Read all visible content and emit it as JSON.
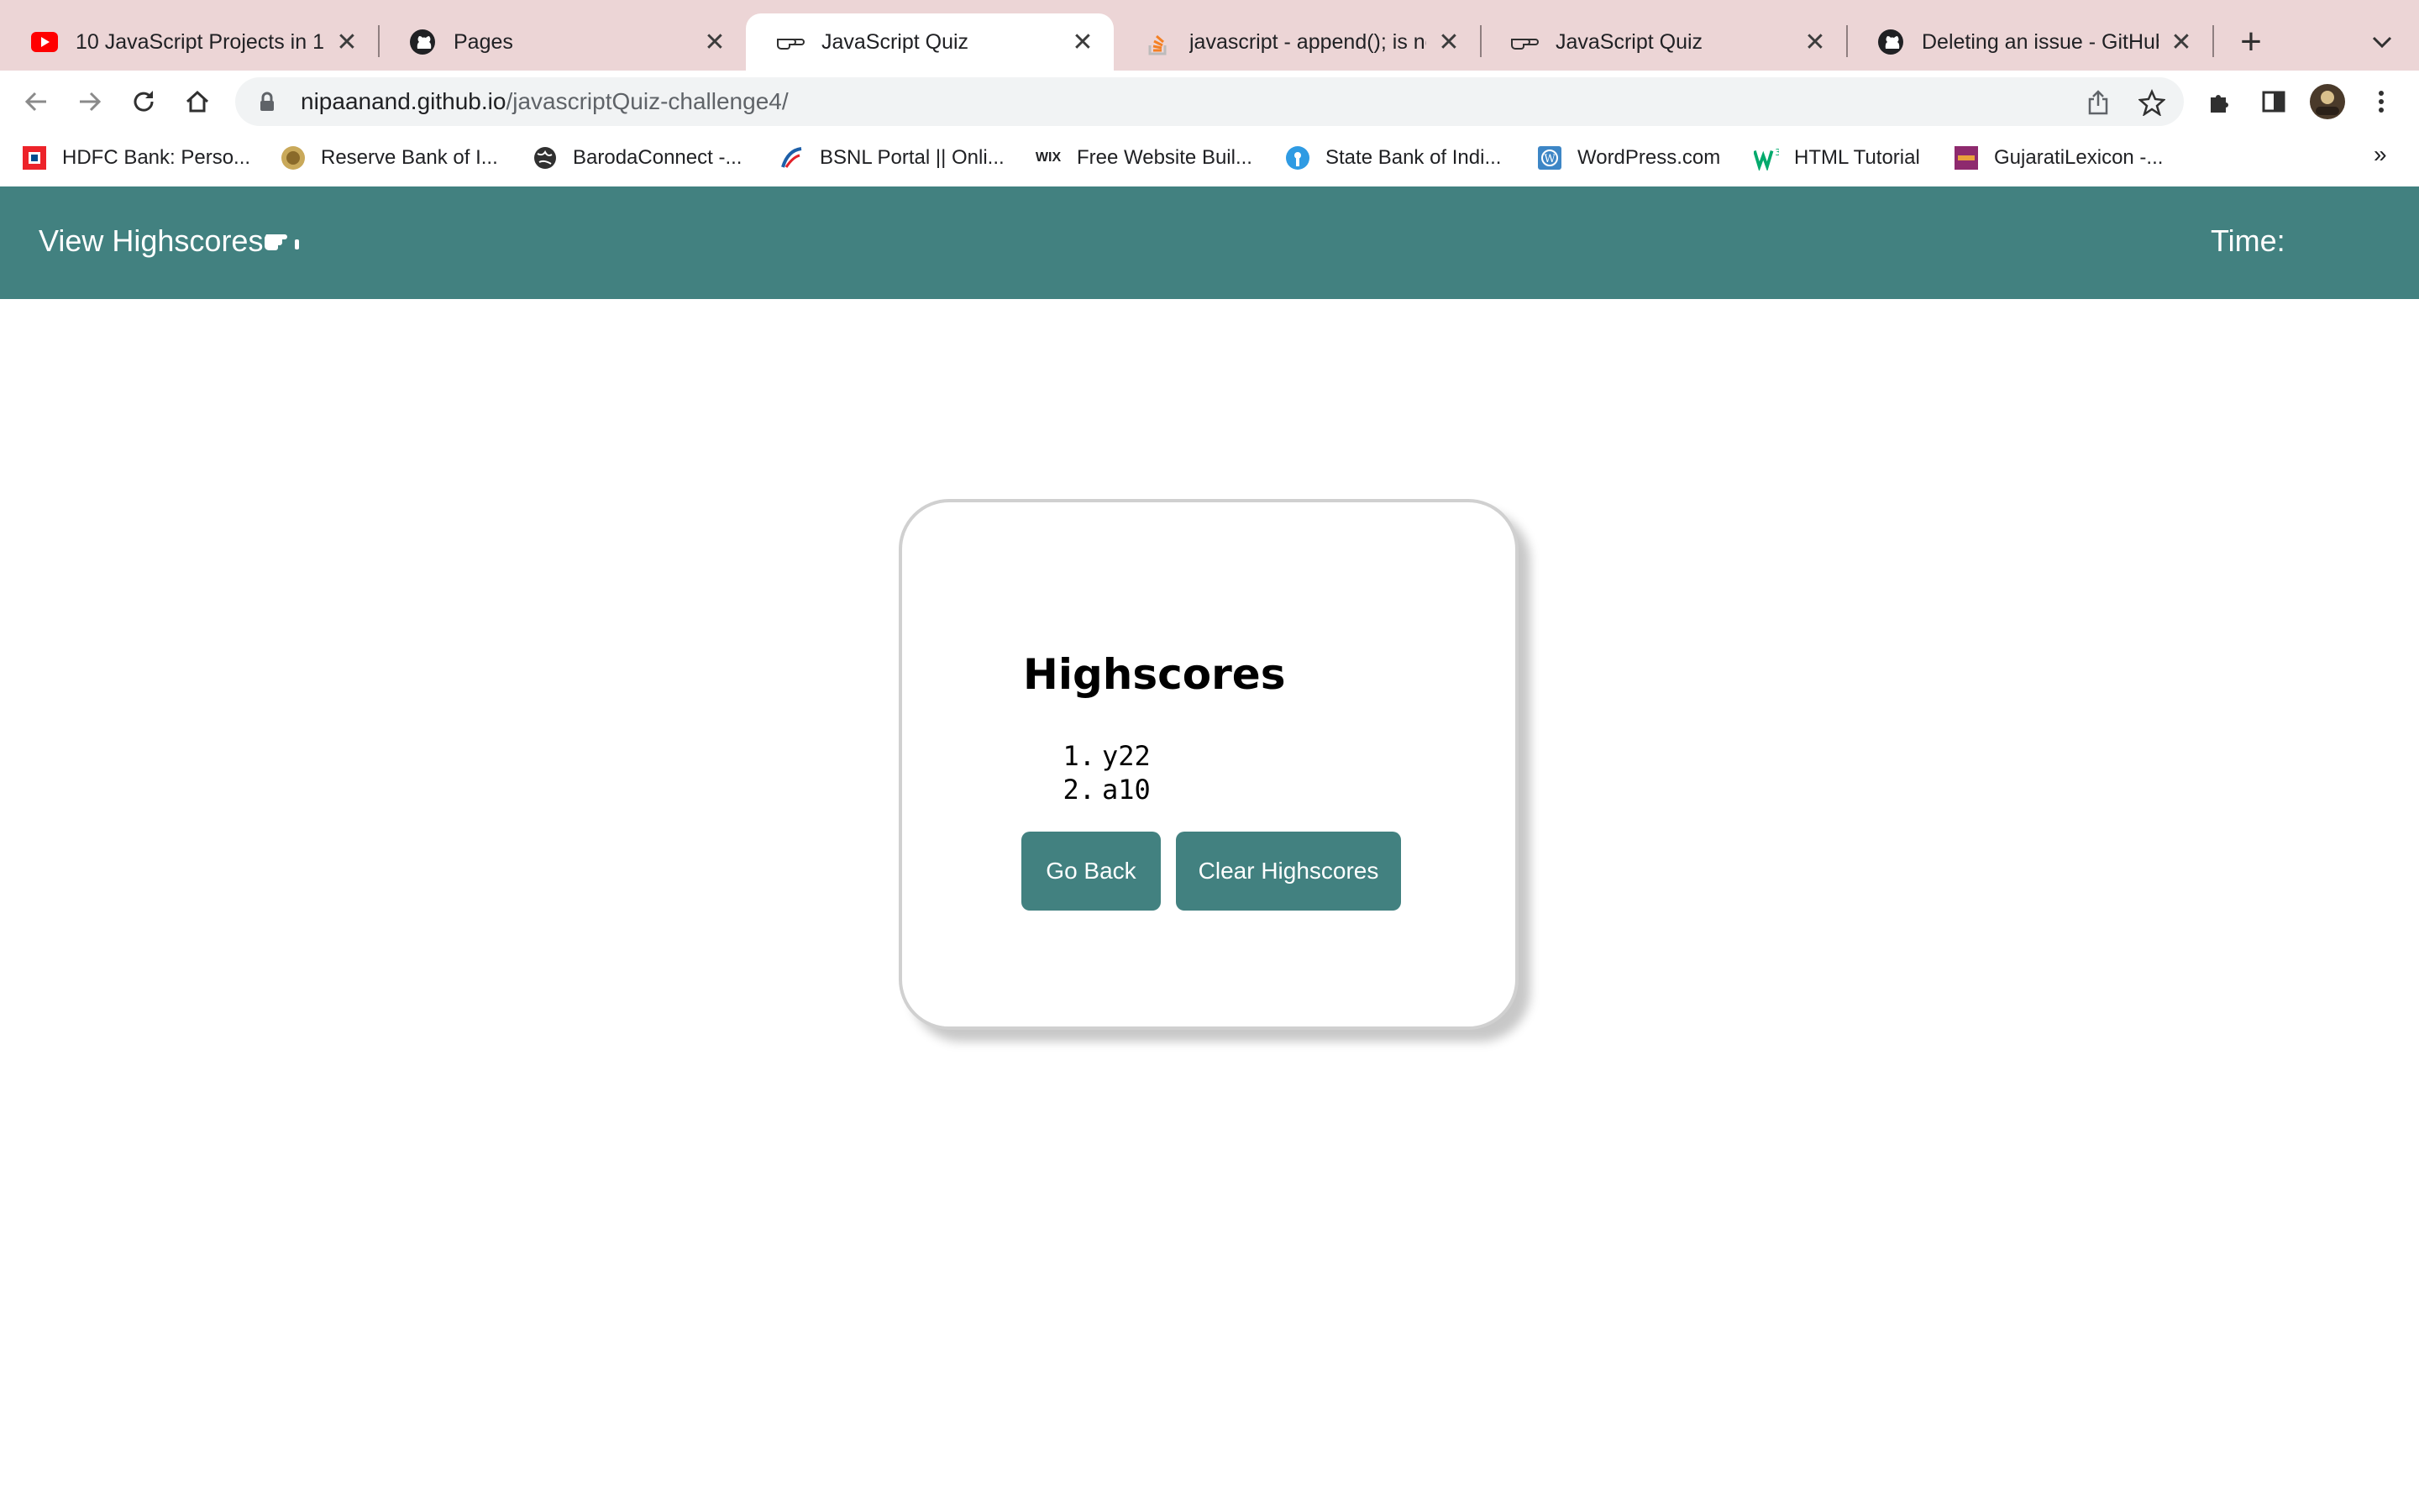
{
  "browser": {
    "tabs": [
      {
        "title": "10 JavaScript Projects in 10",
        "icon": "youtube-icon",
        "active": false
      },
      {
        "title": "Pages",
        "icon": "github-icon",
        "active": false
      },
      {
        "title": "JavaScript Quiz",
        "icon": "pointing-hand-icon",
        "active": true
      },
      {
        "title": "javascript - append(); is no",
        "icon": "stackoverflow-icon",
        "active": false
      },
      {
        "title": "JavaScript Quiz",
        "icon": "pointing-hand-icon",
        "active": false
      },
      {
        "title": "Deleting an issue - GitHub",
        "icon": "github-icon",
        "active": false
      }
    ],
    "new_tab_label": "+",
    "url_host": "nipaanand.github.io",
    "url_path": "/javascriptQuiz-challenge4/",
    "bookmarks": [
      {
        "label": "HDFC Bank: Perso...",
        "icon": "hdfc-icon"
      },
      {
        "label": "Reserve Bank of I...",
        "icon": "rbi-icon"
      },
      {
        "label": "BarodaConnect -...",
        "icon": "globe-icon"
      },
      {
        "label": "BSNL Portal || Onli...",
        "icon": "bsnl-icon"
      },
      {
        "label": "Free Website Buil...",
        "icon": "wix-icon"
      },
      {
        "label": "State Bank of Indi...",
        "icon": "sbi-icon"
      },
      {
        "label": "WordPress.com",
        "icon": "wordpress-icon"
      },
      {
        "label": "HTML Tutorial",
        "icon": "w3schools-icon"
      },
      {
        "label": "GujaratiLexicon -...",
        "icon": "gujaratilexicon-icon"
      }
    ],
    "bookmarks_overflow": "»",
    "wix_text": "WIX"
  },
  "header": {
    "view_highscores": "View Highscores",
    "time_label": "Time:",
    "time_value": ""
  },
  "highscores": {
    "title": "Highscores",
    "entries": [
      {
        "rank": "1.",
        "score": "y22"
      },
      {
        "rank": "2.",
        "score": "a10"
      }
    ],
    "go_back_label": "Go Back",
    "clear_label": "Clear Highscores"
  },
  "colors": {
    "accent": "#428180",
    "tabstrip": "#ecd5d6"
  }
}
